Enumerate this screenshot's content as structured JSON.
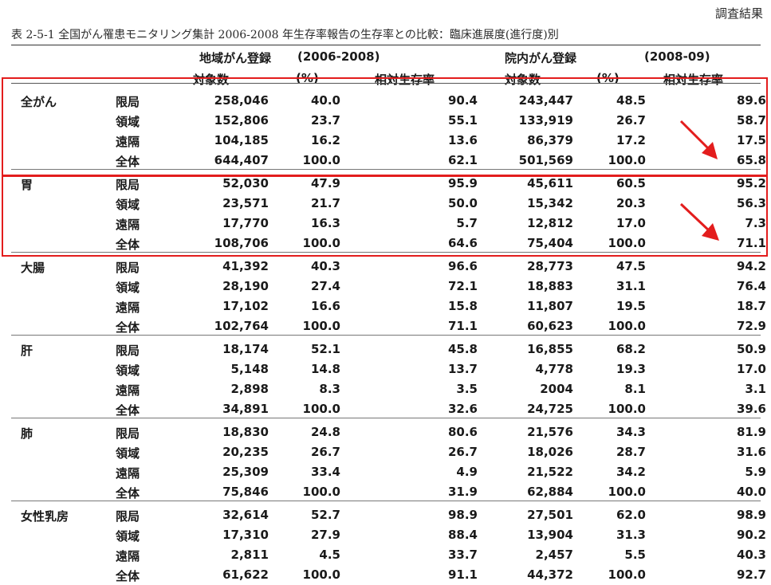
{
  "result_label": "調査結果",
  "caption": "表 2-5-1  全国がん罹患モニタリング集計 2006-2008 年生存率報告の生存率との比較：臨床進展度(進行度)別",
  "group1": {
    "title": "地域がん登録",
    "span": "(2006-2008)"
  },
  "group2": {
    "title": "院内がん登録",
    "span": "(2008-09)"
  },
  "columns": {
    "n1": "対象数",
    "p1": "(%)",
    "r1": "相対生存率",
    "n2": "対象数",
    "p2": "(%)",
    "r2": "相対生存率"
  },
  "colors": {
    "highlight": "#e31d1d"
  },
  "sections": [
    {
      "cancer": "全がん",
      "rows": [
        {
          "stage": "限局",
          "n1": "258,046",
          "p1": "40.0",
          "r1": "90.4",
          "n2": "243,447",
          "p2": "48.5",
          "r2": "89.6"
        },
        {
          "stage": "領域",
          "n1": "152,806",
          "p1": "23.7",
          "r1": "55.1",
          "n2": "133,919",
          "p2": "26.7",
          "r2": "58.7"
        },
        {
          "stage": "遠隔",
          "n1": "104,185",
          "p1": "16.2",
          "r1": "13.6",
          "n2": "86,379",
          "p2": "17.2",
          "r2": "17.5"
        },
        {
          "stage": "全体",
          "n1": "644,407",
          "p1": "100.0",
          "r1": "62.1",
          "n2": "501,569",
          "p2": "100.0",
          "r2": "65.8"
        }
      ]
    },
    {
      "cancer": "胃",
      "rows": [
        {
          "stage": "限局",
          "n1": "52,030",
          "p1": "47.9",
          "r1": "95.9",
          "n2": "45,611",
          "p2": "60.5",
          "r2": "95.2"
        },
        {
          "stage": "領域",
          "n1": "23,571",
          "p1": "21.7",
          "r1": "50.0",
          "n2": "15,342",
          "p2": "20.3",
          "r2": "56.3"
        },
        {
          "stage": "遠隔",
          "n1": "17,770",
          "p1": "16.3",
          "r1": "5.7",
          "n2": "12,812",
          "p2": "17.0",
          "r2": "7.3"
        },
        {
          "stage": "全体",
          "n1": "108,706",
          "p1": "100.0",
          "r1": "64.6",
          "n2": "75,404",
          "p2": "100.0",
          "r2": "71.1"
        }
      ]
    },
    {
      "cancer": "大腸",
      "rows": [
        {
          "stage": "限局",
          "n1": "41,392",
          "p1": "40.3",
          "r1": "96.6",
          "n2": "28,773",
          "p2": "47.5",
          "r2": "94.2"
        },
        {
          "stage": "領域",
          "n1": "28,190",
          "p1": "27.4",
          "r1": "72.1",
          "n2": "18,883",
          "p2": "31.1",
          "r2": "76.4"
        },
        {
          "stage": "遠隔",
          "n1": "17,102",
          "p1": "16.6",
          "r1": "15.8",
          "n2": "11,807",
          "p2": "19.5",
          "r2": "18.7"
        },
        {
          "stage": "全体",
          "n1": "102,764",
          "p1": "100.0",
          "r1": "71.1",
          "n2": "60,623",
          "p2": "100.0",
          "r2": "72.9"
        }
      ]
    },
    {
      "cancer": "肝",
      "rows": [
        {
          "stage": "限局",
          "n1": "18,174",
          "p1": "52.1",
          "r1": "45.8",
          "n2": "16,855",
          "p2": "68.2",
          "r2": "50.9"
        },
        {
          "stage": "領域",
          "n1": "5,148",
          "p1": "14.8",
          "r1": "13.7",
          "n2": "4,778",
          "p2": "19.3",
          "r2": "17.0"
        },
        {
          "stage": "遠隔",
          "n1": "2,898",
          "p1": "8.3",
          "r1": "3.5",
          "n2": "2004",
          "p2": "8.1",
          "r2": "3.1"
        },
        {
          "stage": "全体",
          "n1": "34,891",
          "p1": "100.0",
          "r1": "32.6",
          "n2": "24,725",
          "p2": "100.0",
          "r2": "39.6"
        }
      ]
    },
    {
      "cancer": "肺",
      "rows": [
        {
          "stage": "限局",
          "n1": "18,830",
          "p1": "24.8",
          "r1": "80.6",
          "n2": "21,576",
          "p2": "34.3",
          "r2": "81.9"
        },
        {
          "stage": "領域",
          "n1": "20,235",
          "p1": "26.7",
          "r1": "26.7",
          "n2": "18,026",
          "p2": "28.7",
          "r2": "31.6"
        },
        {
          "stage": "遠隔",
          "n1": "25,309",
          "p1": "33.4",
          "r1": "4.9",
          "n2": "21,522",
          "p2": "34.2",
          "r2": "5.9"
        },
        {
          "stage": "全体",
          "n1": "75,846",
          "p1": "100.0",
          "r1": "31.9",
          "n2": "62,884",
          "p2": "100.0",
          "r2": "40.0"
        }
      ]
    },
    {
      "cancer": "女性乳房",
      "rows": [
        {
          "stage": "限局",
          "n1": "32,614",
          "p1": "52.7",
          "r1": "98.9",
          "n2": "27,501",
          "p2": "62.0",
          "r2": "98.9"
        },
        {
          "stage": "領域",
          "n1": "17,310",
          "p1": "27.9",
          "r1": "88.4",
          "n2": "13,904",
          "p2": "31.3",
          "r2": "90.2"
        },
        {
          "stage": "遠隔",
          "n1": "2,811",
          "p1": "4.5",
          "r1": "33.7",
          "n2": "2,457",
          "p2": "5.5",
          "r2": "40.3"
        },
        {
          "stage": "全体",
          "n1": "61,622",
          "p1": "100.0",
          "r1": "91.1",
          "n2": "44,372",
          "p2": "100.0",
          "r2": "92.7"
        }
      ]
    }
  ]
}
